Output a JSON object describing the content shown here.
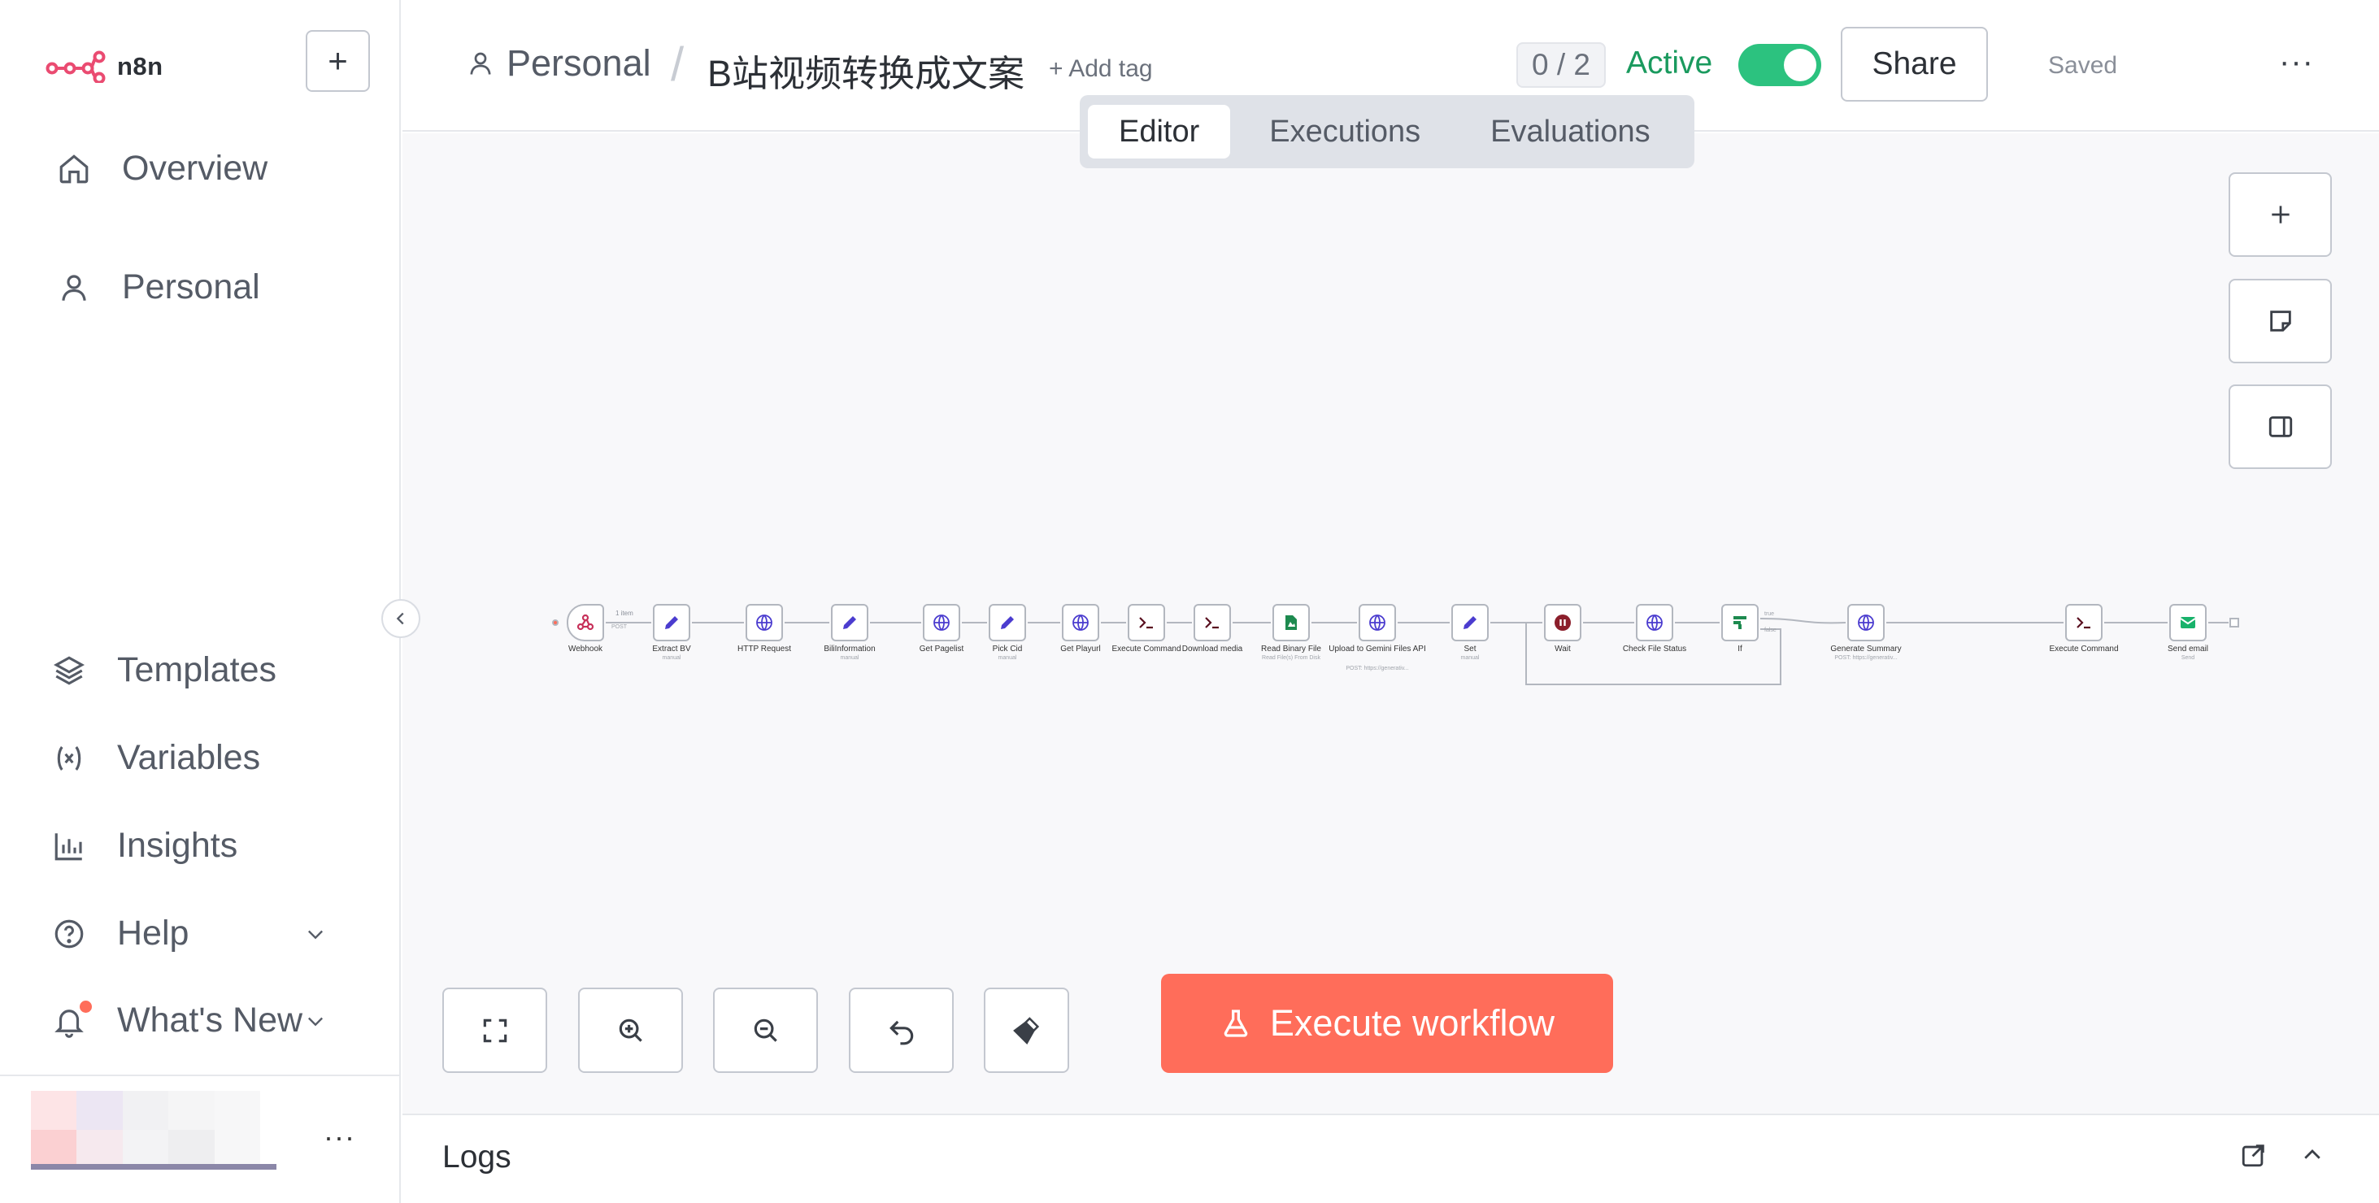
{
  "sidebar": {
    "logo_text": "n8n",
    "new_button": "+",
    "nav": {
      "overview": "Overview",
      "personal": "Personal"
    },
    "bottom": {
      "templates": "Templates",
      "variables": "Variables",
      "insights": "Insights",
      "help": "Help",
      "whats_new": "What's New"
    },
    "user_more": "···"
  },
  "header": {
    "breadcrumb_project": "Personal",
    "separator": "/",
    "workflow_name": "B站视频转换成文案",
    "add_tag": "+ Add tag",
    "counter": "0 / 2",
    "active_label": "Active",
    "active": true,
    "share": "Share",
    "saved": "Saved",
    "more": "···"
  },
  "tabs": [
    "Editor",
    "Executions",
    "Evaluations"
  ],
  "active_tab": "Editor",
  "workflow": {
    "nodes": [
      {
        "name": "Webhook",
        "sub": "",
        "icon": "webhook-icon"
      },
      {
        "name": "Extract BV",
        "sub": "manual",
        "icon": "pencil-icon"
      },
      {
        "name": "HTTP Request",
        "sub": "",
        "icon": "globe-icon"
      },
      {
        "name": "BiliInformation",
        "sub": "manual",
        "icon": "pencil-icon"
      },
      {
        "name": "Get Pagelist",
        "sub": "",
        "icon": "globe-icon"
      },
      {
        "name": "Pick Cid",
        "sub": "manual",
        "icon": "pencil-icon"
      },
      {
        "name": "Get Playurl",
        "sub": "",
        "icon": "globe-icon"
      },
      {
        "name": "Execute Command",
        "sub": "",
        "icon": "terminal-icon"
      },
      {
        "name": "Download media",
        "sub": "",
        "icon": "terminal-icon"
      },
      {
        "name": "Read Binary File",
        "sub": "Read File(s) From Disk",
        "icon": "file-icon"
      },
      {
        "name": "Upload to Gemini Files API",
        "sub": "POST: https://generativ...",
        "icon": "globe-icon"
      },
      {
        "name": "Set",
        "sub": "manual",
        "icon": "pencil-icon"
      },
      {
        "name": "Wait",
        "sub": "",
        "icon": "pause-icon"
      },
      {
        "name": "Check File Status",
        "sub": "",
        "icon": "globe-icon"
      },
      {
        "name": "If",
        "sub": "",
        "icon": "if-icon"
      },
      {
        "name": "Generate Summary",
        "sub": "POST: https://generativ...",
        "icon": "globe-icon"
      },
      {
        "name": "Execute Command",
        "sub": "",
        "icon": "terminal-icon"
      },
      {
        "name": "Send email",
        "sub": "Send",
        "icon": "email-icon"
      }
    ],
    "edge_label": "1 item",
    "edge_sub": "POST",
    "if_true": "true",
    "if_false": "false"
  },
  "canvas_tools": {
    "execute_workflow": "Execute workflow"
  },
  "logs": {
    "title": "Logs"
  },
  "colors": {
    "accent": "#ff6d5a",
    "active_green": "#2cc27f",
    "active_text": "#1a9a5e",
    "node_edit": "#4b3ccf",
    "node_http": "#4b3ccf",
    "node_wait": "#8b1e2b",
    "node_if": "#1d8a4f",
    "node_email": "#19b26b"
  }
}
